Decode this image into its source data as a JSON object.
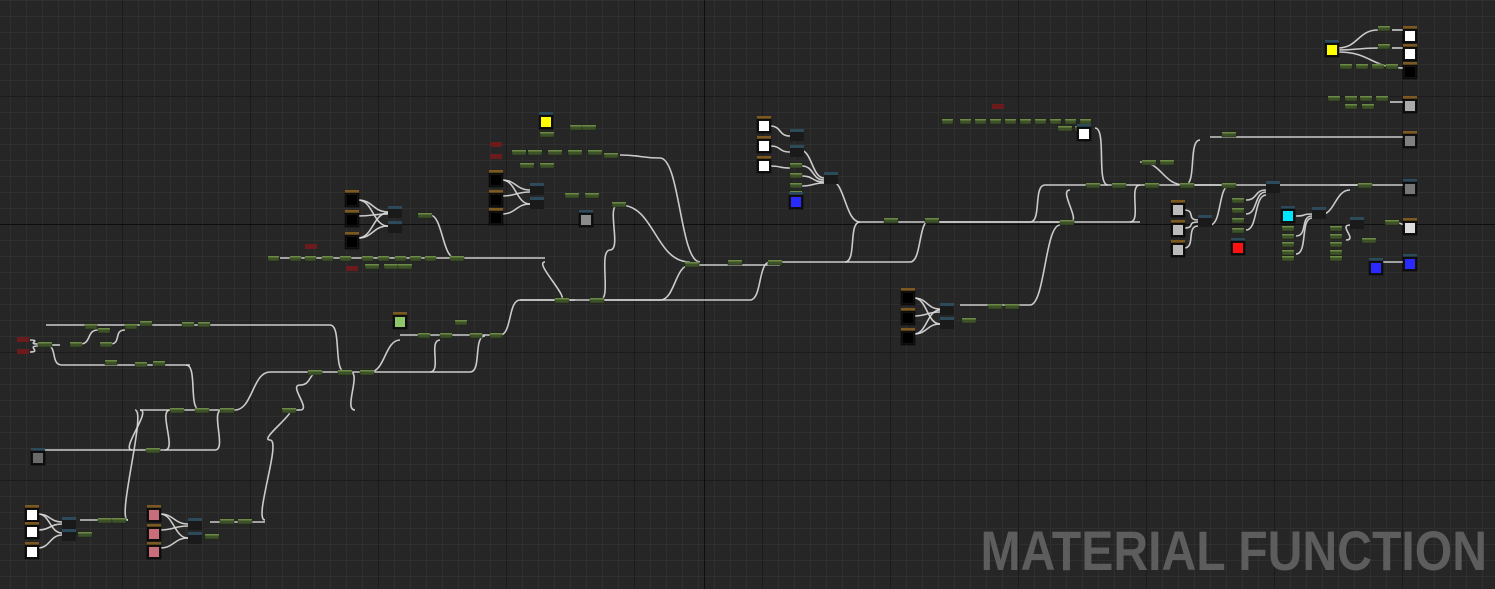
{
  "editor": {
    "watermark": "MATERIAL FUNCTION"
  },
  "colors": {
    "background": "#262626",
    "wire": "#d9d9d9",
    "math_node": "#3e5229",
    "param_node": "#2d4a5a",
    "texture_node": "#7a5a22",
    "constant_node": "#6b1b1b",
    "preview_white": "#ffffff",
    "preview_yellow": "#ffff00",
    "preview_blue": "#2a2aff",
    "preview_cyan": "#00e5ff",
    "preview_red": "#ff1111",
    "preview_green": "#8ec56b",
    "preview_pink": "#c86e7a",
    "preview_gray": "#808080",
    "preview_black": "#000000"
  }
}
